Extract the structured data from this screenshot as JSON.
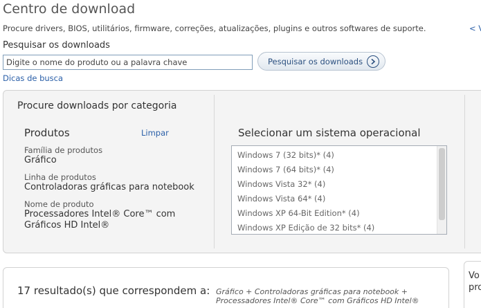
{
  "header": {
    "title": "Centro de download",
    "subtitle": "Procure drivers, BIOS, utilitários, firmware, correções, atualizações, plugins e outros softwares de suporte.",
    "side_link": "< V"
  },
  "search": {
    "label": "Pesquisar os downloads",
    "placeholder": "Digite o nome do produto ou a palavra chave",
    "button_label": "Pesquisar os downloads",
    "tips_link": "Dicas de busca"
  },
  "category": {
    "title": "Procure downloads por categoria",
    "products_heading": "Produtos",
    "clear_link": "Limpar",
    "fields": [
      {
        "label": "Família de produtos",
        "value": "Gráfico"
      },
      {
        "label": "Linha de produtos",
        "value": "Controladoras gráficas para notebook"
      },
      {
        "label": "Nome de produto",
        "value": "Processadores Intel® Core™ com Gráficos HD Intel®"
      }
    ],
    "os_heading": "Selecionar um sistema operacional",
    "os_options": [
      "Windows 7 (32 bits)* (4)",
      "Windows 7 (64 bits)* (4)",
      "Windows Vista 32* (4)",
      "Windows Vista 64* (4)",
      "Windows XP 64-Bit Edition* (4)",
      "Windows XP Edição de 32 bits* (4)"
    ]
  },
  "results": {
    "count_text": "17 resultado(s) que correspondem a:",
    "query_text": "Gráfico + Controladoras gráficas para notebook + Processadores Intel® Core™ com Gráficos HD Intel®"
  },
  "right_panel": {
    "text": "Vo pro"
  }
}
